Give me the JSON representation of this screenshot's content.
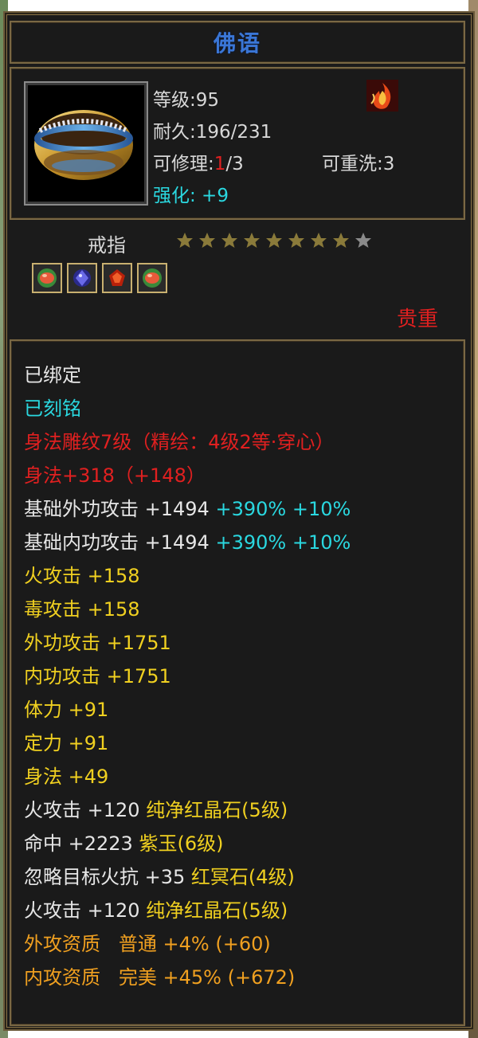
{
  "item": {
    "name": "佛语",
    "level": "等级:95",
    "durability": "耐久:196/231",
    "repair_prefix": "可修理:",
    "repair_current": "1",
    "repair_suffix": "/3",
    "rewash": "可重洗:3",
    "enhance": "强化: +9",
    "type": "戒指",
    "stars_filled": 8,
    "stars_total": 9,
    "rarity": "贵重"
  },
  "gems": [
    "green-red-gem-icon",
    "blue-gem-icon",
    "red-gem-icon",
    "green-red-gem-icon"
  ],
  "properties": {
    "bound": "已绑定",
    "engraved": "已刻铭",
    "carving": "身法雕纹7级（精绘：4级2等·穿心）",
    "agility_bonus": "身法+318（+148）",
    "base_outer_attack": {
      "label": "基础外功攻击",
      "value": "+1494",
      "pct1": "+390%",
      "pct2": "+10%"
    },
    "base_inner_attack": {
      "label": "基础内功攻击",
      "value": "+1494",
      "pct1": "+390%",
      "pct2": "+10%"
    },
    "fire_attack": "火攻击 +158",
    "poison_attack": "毒攻击 +158",
    "outer_attack": "外功攻击 +1751",
    "inner_attack": "内功攻击 +1751",
    "stamina": "体力 +91",
    "concentration": "定力 +91",
    "agility": "身法 +49",
    "gem1": {
      "stat": "火攻击 +120",
      "gem": "纯净红晶石(5级)"
    },
    "gem2": {
      "stat": "命中 +2223",
      "gem": "紫玉(6级)"
    },
    "gem3": {
      "stat": "忽略目标火抗 +35",
      "gem": "红冥石(4级)"
    },
    "gem4": {
      "stat": "火攻击 +120",
      "gem": "纯净红晶石(5级)"
    },
    "outer_quality": {
      "label": "外攻资质",
      "grade": "普通",
      "value": "+4% (+60)"
    },
    "inner_quality": {
      "label": "内攻资质",
      "grade": "完美",
      "value": "+45% (+672)"
    }
  },
  "colors": {
    "title": "#3a76d6",
    "cyan": "#2ad8e0",
    "red": "#e02020",
    "yellow": "#f0d020",
    "orange": "#f0a020"
  }
}
